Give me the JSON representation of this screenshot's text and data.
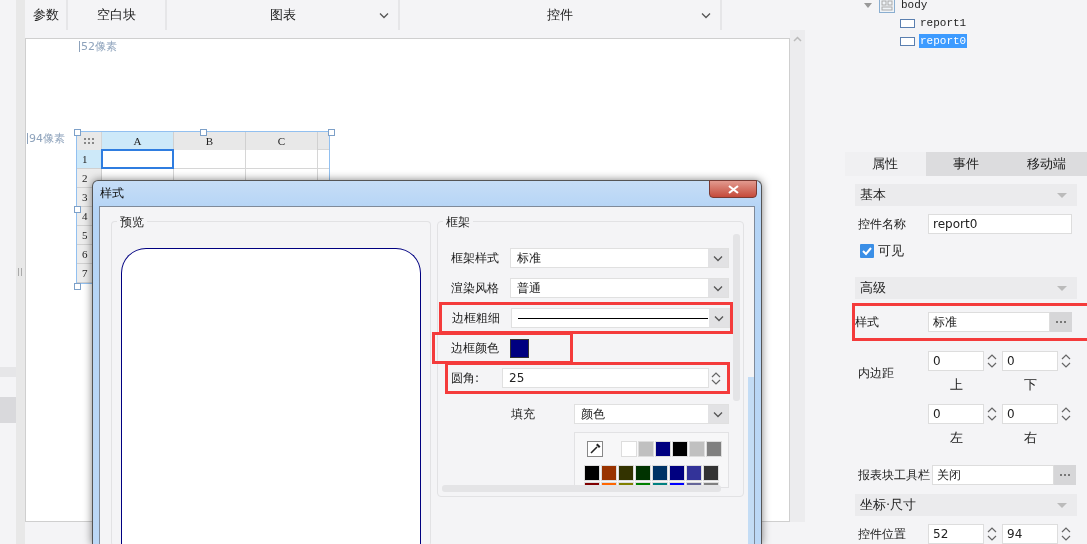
{
  "toolbar": {
    "items": [
      {
        "label": "参数",
        "dropdown": false
      },
      {
        "label": "空白块",
        "dropdown": false
      },
      {
        "label": "图表",
        "dropdown": true
      },
      {
        "label": "控件",
        "dropdown": true
      }
    ]
  },
  "canvas": {
    "x_marker": "52像素",
    "y_marker": "94像素",
    "grid": {
      "columns": [
        {
          "label": "A",
          "selected": true
        },
        {
          "label": "B",
          "selected": false
        },
        {
          "label": "C",
          "selected": false
        }
      ],
      "rows": [
        {
          "label": "1",
          "selected": true
        },
        {
          "label": "2",
          "selected": false
        },
        {
          "label": "3",
          "selected": false
        },
        {
          "label": "4",
          "selected": false
        },
        {
          "label": "5",
          "selected": false
        },
        {
          "label": "6",
          "selected": false
        },
        {
          "label": "7",
          "selected": false
        }
      ]
    }
  },
  "dialog": {
    "title": "样式",
    "preview": {
      "legend": "预览"
    },
    "frame": {
      "legend": "框架",
      "fields": [
        {
          "kind": "select",
          "label": "框架样式",
          "value": "标准",
          "highlighted": false
        },
        {
          "kind": "select",
          "label": "渲染风格",
          "value": "普通",
          "highlighted": false
        },
        {
          "kind": "line",
          "label": "边框粗细",
          "highlighted": true
        },
        {
          "kind": "color",
          "label": "边框颜色",
          "color": "#000080",
          "highlighted": true
        },
        {
          "kind": "spinner",
          "label": "圆角:",
          "value": "25",
          "highlighted": true
        }
      ],
      "fill": {
        "label": "填充",
        "value": "颜色"
      },
      "palette": {
        "recent": [
          {
            "color": "#ffffff"
          },
          {
            "color": "#c0c0c0"
          },
          {
            "color": "#000080"
          },
          {
            "color": "#000000"
          },
          {
            "color": "#c0c0c0"
          },
          {
            "color": "#808080"
          }
        ],
        "swatches": [
          {
            "color": "#000000"
          },
          {
            "color": "#993300"
          },
          {
            "color": "#333300"
          },
          {
            "color": "#003300"
          },
          {
            "color": "#003366"
          },
          {
            "color": "#000080"
          },
          {
            "color": "#333399"
          },
          {
            "color": "#333333"
          },
          {
            "color": "#800000"
          },
          {
            "color": "#ff6600"
          },
          {
            "color": "#808000"
          },
          {
            "color": "#008000"
          },
          {
            "color": "#008080"
          },
          {
            "color": "#0000ff"
          },
          {
            "color": "#666699"
          },
          {
            "color": "#808080"
          }
        ]
      }
    }
  },
  "tree": [
    {
      "label": "body",
      "expanded": true,
      "selected": false,
      "children": [
        {
          "label": "report1",
          "selected": false
        },
        {
          "label": "report0",
          "selected": true
        }
      ]
    }
  ],
  "tabs": [
    {
      "label": "属性",
      "selected": true
    },
    {
      "label": "事件",
      "selected": false
    },
    {
      "label": "移动端",
      "selected": false
    }
  ],
  "properties": [
    {
      "title": "基本",
      "rows": [
        {
          "kind": "text",
          "label": "控件名称",
          "value": "report0",
          "highlighted": false
        },
        {
          "kind": "checkbox",
          "label": "可见",
          "checked": true
        }
      ]
    },
    {
      "title": "高级",
      "rows": [
        {
          "kind": "more",
          "label": "样式",
          "value": "标准",
          "highlighted": true
        },
        {
          "kind": "spin_pair",
          "label": "内边距",
          "fields": [
            {
              "value": "0",
              "caption": "上"
            },
            {
              "value": "0",
              "caption": "下"
            }
          ]
        },
        {
          "kind": "spin_pair",
          "fields": [
            {
              "value": "0",
              "caption": "左"
            },
            {
              "value": "0",
              "caption": "右"
            }
          ]
        },
        {
          "kind": "more",
          "label": "报表块工具栏",
          "value": "关闭",
          "highlighted": false
        }
      ]
    },
    {
      "title": "坐标·尺寸",
      "rows": [
        {
          "kind": "spin_pair",
          "label": "控件位置",
          "fields": [
            {
              "value": "52"
            },
            {
              "value": "94"
            }
          ]
        }
      ]
    }
  ]
}
